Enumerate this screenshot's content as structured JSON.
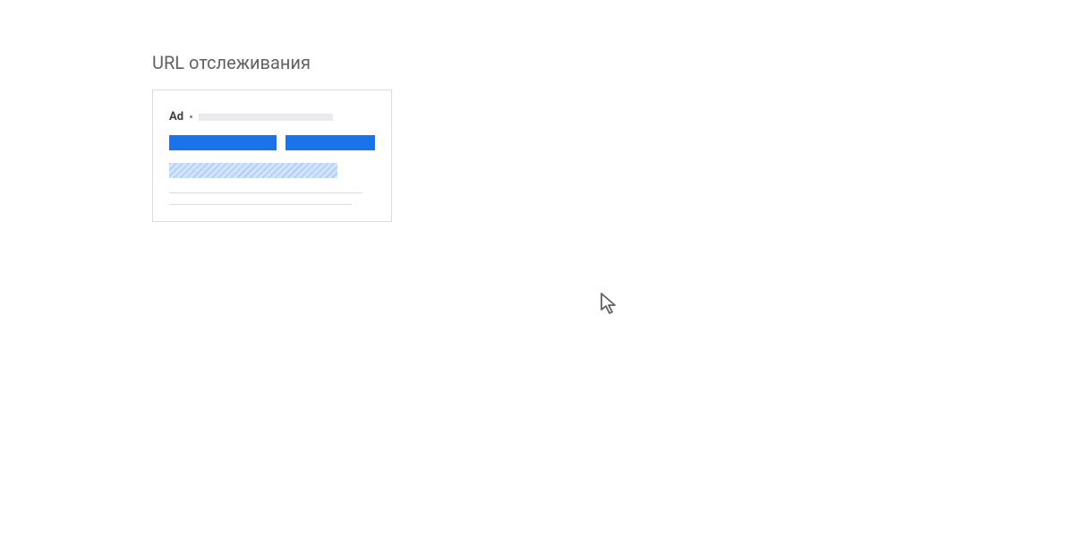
{
  "title": "URL отслеживания",
  "preview": {
    "ad_label": "Ad"
  }
}
